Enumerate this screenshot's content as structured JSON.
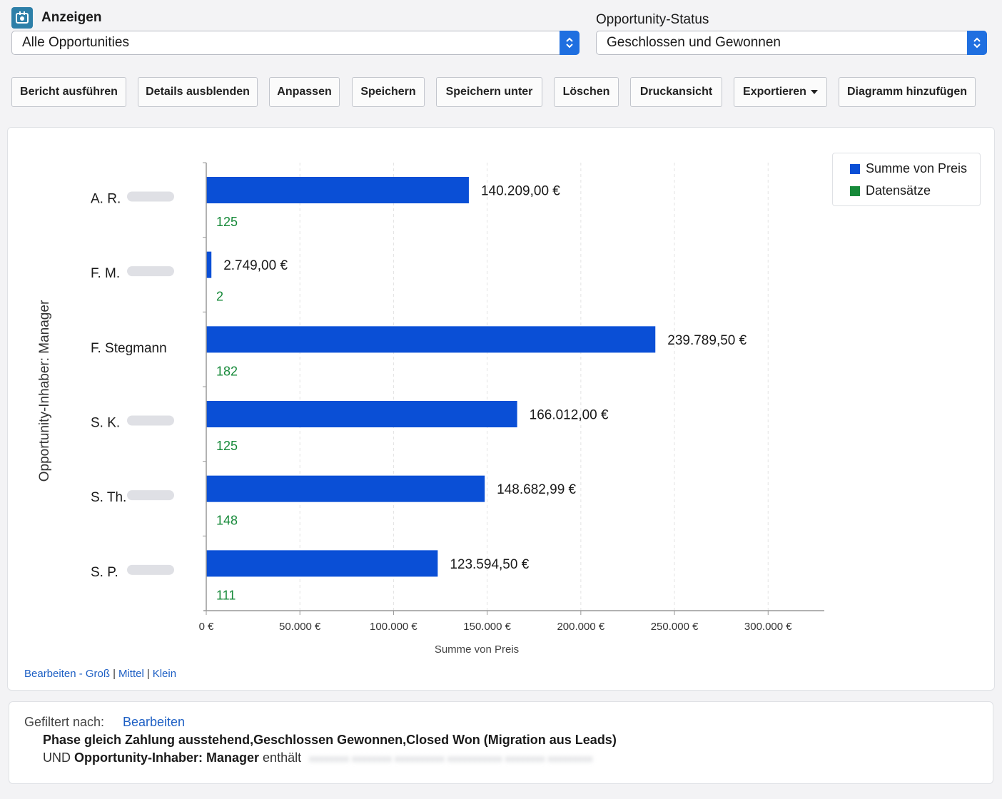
{
  "header": {
    "view_label": "Anzeigen",
    "view_value": "Alle Opportunities",
    "status_label": "Opportunity-Status",
    "status_value": "Geschlossen und Gewonnen"
  },
  "toolbar": {
    "buttons": [
      "Bericht ausführen",
      "Details ausblenden",
      "Anpassen",
      "Speichern",
      "Speichern unter",
      "Löschen",
      "Druckansicht",
      "Exportieren",
      "Diagramm hinzufügen"
    ]
  },
  "colors": {
    "accent_blue": "#1f6fe0",
    "bar_blue": "#0a4fd6",
    "count_green": "#178a3a",
    "link_blue": "#1d5fc4"
  },
  "chart_data": {
    "type": "bar",
    "orientation": "horizontal",
    "ylabel": "Opportunity-Inhaber: Manager",
    "xlabel": "Summe von Preis",
    "categories": [
      "A. R.",
      "F. M.",
      "F. Stegmann",
      "S. K.",
      "S. Th.",
      "S. P."
    ],
    "series": [
      {
        "name": "Summe von Preis",
        "values": [
          140209.0,
          2749.0,
          239789.5,
          166012.0,
          148682.99,
          123594.5
        ],
        "labels": [
          "140.209,00 €",
          "2.749,00 €",
          "239.789,50 €",
          "166.012,00 €",
          "148.682,99 €",
          "123.594,50 €"
        ]
      },
      {
        "name": "Datensätze",
        "values": [
          125,
          2,
          182,
          125,
          148,
          111
        ]
      }
    ],
    "xticks": [
      {
        "value": 0,
        "label": "0 €"
      },
      {
        "value": 50000,
        "label": "50.000 €"
      },
      {
        "value": 100000,
        "label": "100.000 €"
      },
      {
        "value": 150000,
        "label": "150.000 €"
      },
      {
        "value": 200000,
        "label": "200.000 €"
      },
      {
        "value": 250000,
        "label": "250.000 €"
      },
      {
        "value": 300000,
        "label": "300.000 €"
      }
    ],
    "xlim": [
      0,
      330000
    ],
    "grid": true,
    "legend_position": "top-right"
  },
  "size_links": {
    "edit": "Bearbeiten - Groß",
    "medium": "Mittel",
    "small": "Klein"
  },
  "filter": {
    "label": "Gefiltert nach:",
    "edit": "Bearbeiten",
    "line1": "Phase gleich Zahlung ausstehend,Geschlossen Gewonnen,Closed Won (Migration aus Leads)",
    "line2_prefix": "UND",
    "line2_field": "Opportunity-Inhaber: Manager",
    "line2_op": "enthält"
  }
}
